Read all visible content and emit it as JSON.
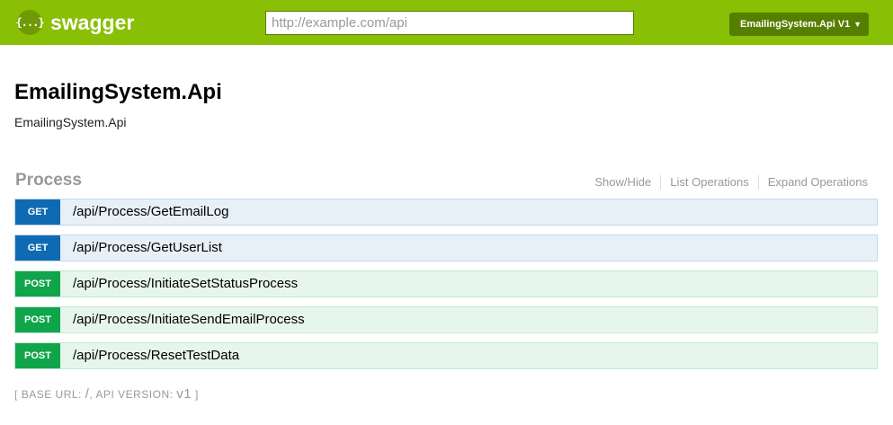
{
  "header": {
    "logo_glyph": "{...}",
    "brand": "swagger",
    "url_placeholder": "http://example.com/api",
    "api_select": "EmailingSystem.Api V1",
    "colors": {
      "bar": "#89bf04",
      "select": "#547f00"
    }
  },
  "info": {
    "title": "EmailingSystem.Api",
    "description": "EmailingSystem.Api"
  },
  "resource": {
    "name": "Process",
    "links": [
      "Show/Hide",
      "List Operations",
      "Expand Operations"
    ],
    "operations": [
      {
        "method": "GET",
        "path": "/api/Process/GetEmailLog"
      },
      {
        "method": "GET",
        "path": "/api/Process/GetUserList"
      },
      {
        "method": "POST",
        "path": "/api/Process/InitiateSetStatusProcess"
      },
      {
        "method": "POST",
        "path": "/api/Process/InitiateSendEmailProcess"
      },
      {
        "method": "POST",
        "path": "/api/Process/ResetTestData"
      }
    ]
  },
  "footer": {
    "open": "[",
    "base_url_label": "BASE URL:",
    "base_url": "/",
    "sep": ",",
    "api_version_label": "API VERSION:",
    "api_version": "v1",
    "close": "]"
  }
}
